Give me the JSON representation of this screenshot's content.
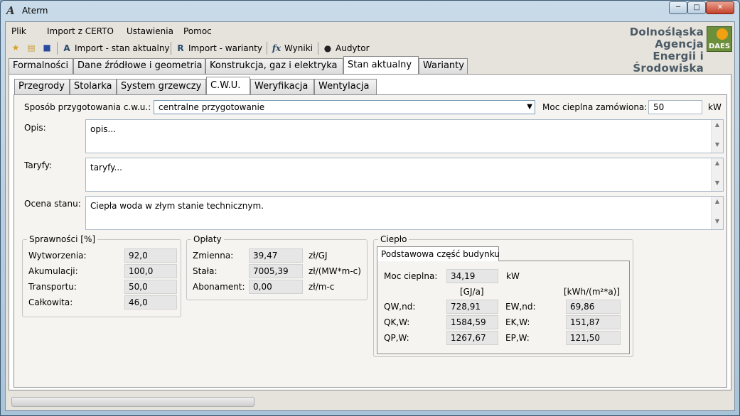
{
  "window": {
    "title": "Aterm",
    "icon": "aterm-app-icon",
    "controls": {
      "minimize": "minimize-icon",
      "maximize": "maximize-icon",
      "close": "close-icon"
    }
  },
  "menu": [
    "Plik",
    "Import z CERTO",
    "Ustawienia",
    "Pomoc"
  ],
  "toolbar": {
    "icons": [
      "new-file-icon",
      "open-folder-icon",
      "save-icon"
    ],
    "buttons": [
      {
        "label": "Import - stan aktualny",
        "icon": "import-a-icon"
      },
      {
        "label": "Import - warianty",
        "icon": "import-r-icon"
      },
      {
        "label": "Wyniki",
        "icon": "fx-icon"
      },
      {
        "label": "Audytor",
        "icon": "auditor-icon"
      }
    ]
  },
  "logo": {
    "line1": "Dolnośląska Agencja",
    "line2": "Energii i Środowiska",
    "mark": "DAES"
  },
  "main_tabs": [
    "Formalności",
    "Dane źródłowe i geometria",
    "Konstrukcja, gaz i elektryka",
    "Stan aktualny",
    "Warianty"
  ],
  "main_tab_active": "Stan aktualny",
  "sub_tabs": [
    "Przegrody",
    "Stolarka",
    "System grzewczy",
    "C.W.U.",
    "Weryfikacja",
    "Wentylacja"
  ],
  "sub_tab_active": "C.W.U.",
  "cwu": {
    "sposob_label": "Sposób przygotowania c.w.u.:",
    "sposob_value": "centralne przygotowanie",
    "moc_label": "Moc cieplna zamówiona:",
    "moc_value": "50",
    "moc_unit": "kW",
    "opis_label": "Opis:",
    "opis_value": "opis...",
    "taryfy_label": "Taryfy:",
    "taryfy_value": "taryfy...",
    "ocena_label": "Ocena stanu:",
    "ocena_value": "Ciepła woda w złym stanie technicznym."
  },
  "sprawnosci": {
    "title": "Sprawności [%]",
    "rows": [
      {
        "label": "Wytworzenia:",
        "value": "92,0"
      },
      {
        "label": "Akumulacji:",
        "value": "100,0"
      },
      {
        "label": "Transportu:",
        "value": "50,0"
      },
      {
        "label": "Całkowita:",
        "value": "46,0"
      }
    ]
  },
  "oplaty": {
    "title": "Opłaty",
    "rows": [
      {
        "label": "Zmienna:",
        "value": "39,47",
        "unit": "zł/GJ"
      },
      {
        "label": "Stała:",
        "value": "7005,39",
        "unit": "zł/(MW*m-c)"
      },
      {
        "label": "Abonament:",
        "value": "0,00",
        "unit": "zł/m-c"
      }
    ]
  },
  "cieplo": {
    "title": "Ciepło",
    "tab": "Podstawowa część budynku",
    "moc_label": "Moc cieplna:",
    "moc_value": "34,19",
    "moc_unit": "kW",
    "col1_unit": "[GJ/a]",
    "col2_unit": "[kWh/(m²*a)]",
    "rows": [
      {
        "l1": "QW,nd:",
        "v1": "728,91",
        "l2": "EW,nd:",
        "v2": "69,86"
      },
      {
        "l1": "QK,W:",
        "v1": "1584,59",
        "l2": "EK,W:",
        "v2": "151,87"
      },
      {
        "l1": "QP,W:",
        "v1": "1267,67",
        "l2": "EP,W:",
        "v2": "121,50"
      }
    ]
  }
}
